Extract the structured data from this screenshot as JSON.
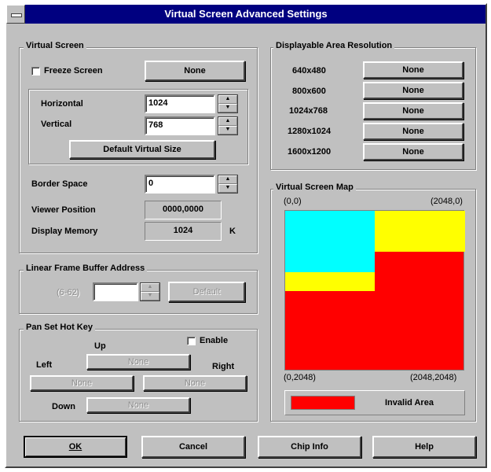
{
  "window": {
    "title": "Virtual Screen Advanced Settings"
  },
  "virtual_screen": {
    "group_label": "Virtual Screen",
    "freeze_label": "Freeze Screen",
    "freeze_button": "None",
    "horizontal_label": "Horizontal",
    "horizontal_value": "1024",
    "vertical_label": "Vertical",
    "vertical_value": "768",
    "default_button": "Default Virtual Size",
    "border_label": "Border Space",
    "border_value": "0",
    "viewer_label": "Viewer Position",
    "viewer_value": "0000,0000",
    "memory_label": "Display Memory",
    "memory_value": "1024",
    "memory_unit": "K"
  },
  "linear_frame": {
    "group_label": "Linear Frame Buffer Address",
    "range_label": "(6-62)",
    "value": "",
    "default_button": "Default"
  },
  "pan_hot_key": {
    "group_label": "Pan Set Hot Key",
    "enable_label": "Enable",
    "up_label": "Up",
    "left_label": "Left",
    "right_label": "Right",
    "down_label": "Down",
    "up_value": "None",
    "left_value": "None",
    "right_value": "None",
    "down_value": "None"
  },
  "resolution": {
    "group_label": "Displayable Area Resolution",
    "items": [
      {
        "label": "640x480",
        "button": "None"
      },
      {
        "label": "800x600",
        "button": "None"
      },
      {
        "label": "1024x768",
        "button": "None"
      },
      {
        "label": "1280x1024",
        "button": "None"
      },
      {
        "label": "1600x1200",
        "button": "None"
      }
    ]
  },
  "map": {
    "group_label": "Virtual Screen Map",
    "top_left": "(0,0)",
    "top_right": "(2048,0)",
    "bottom_left": "(0,2048)",
    "bottom_right": "(2048,2048)",
    "legend_label": "Invalid Area",
    "colors": {
      "viewer": "#00ffff",
      "virtual": "#ffff00",
      "invalid": "#ff0000"
    }
  },
  "footer": {
    "ok": "OK",
    "cancel": "Cancel",
    "chip_info": "Chip Info",
    "help": "Help"
  }
}
